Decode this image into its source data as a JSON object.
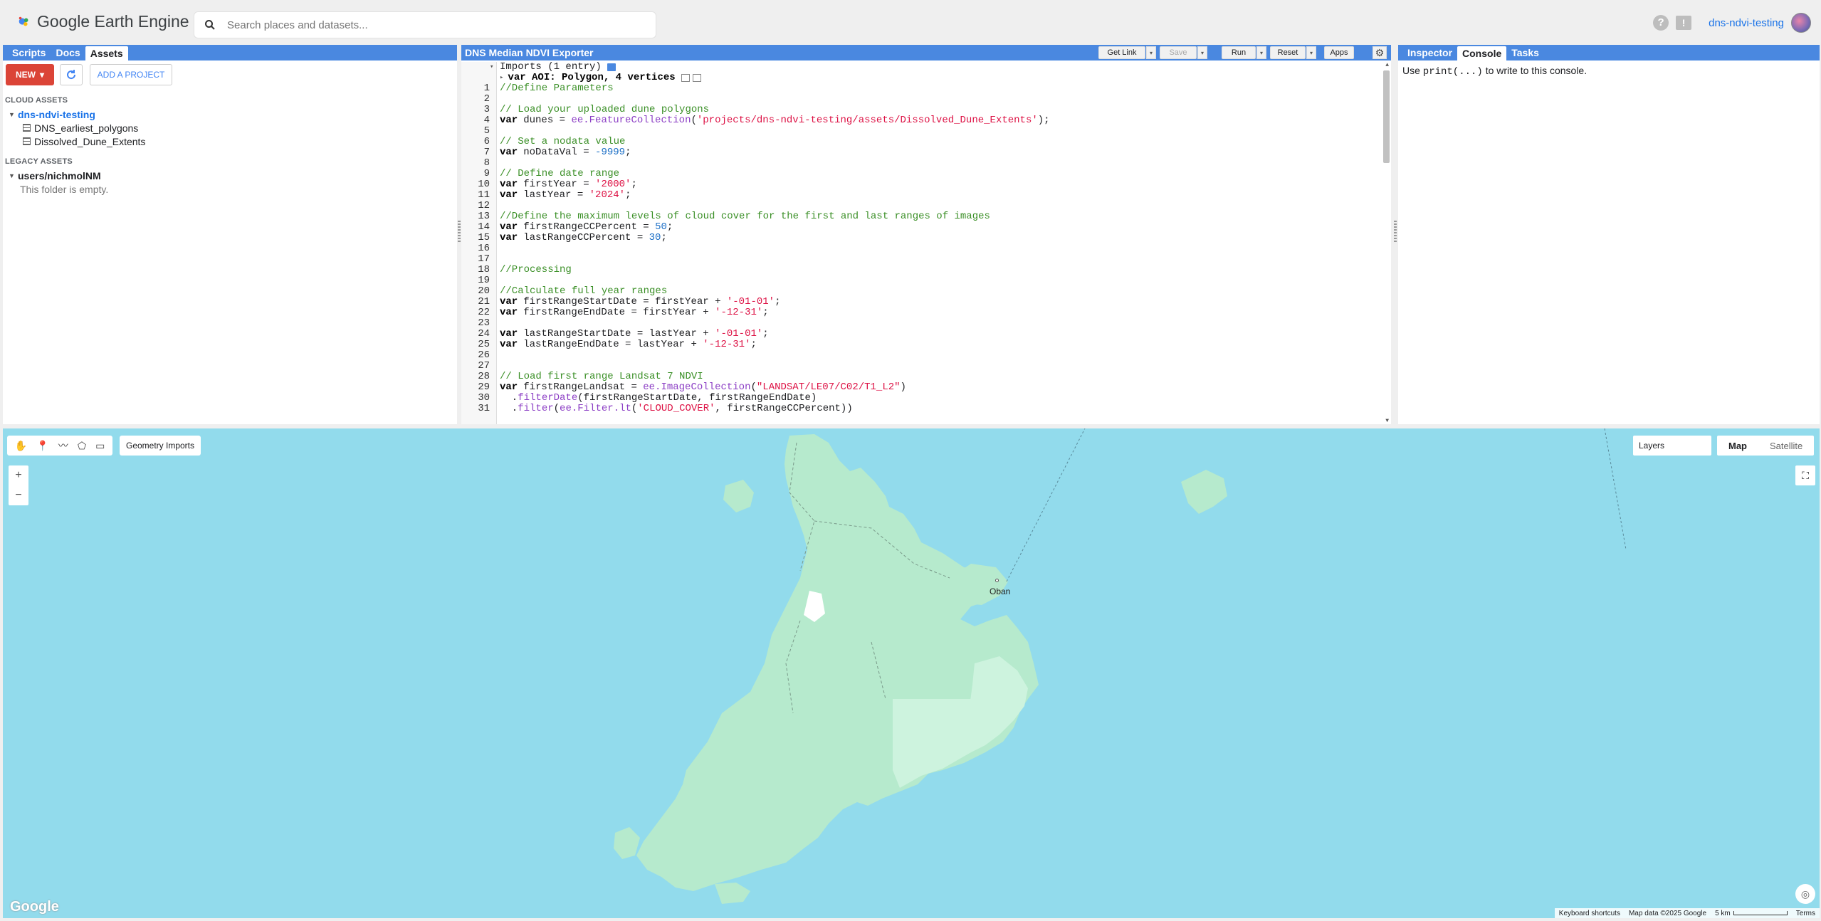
{
  "app": {
    "title": "Google Earth Engine"
  },
  "search": {
    "placeholder": "Search places and datasets..."
  },
  "topbar": {
    "project": "dns-ndvi-testing",
    "help": "?",
    "feedback": "!"
  },
  "left_panel": {
    "tabs": [
      "Scripts",
      "Docs",
      "Assets"
    ],
    "active_tab": "Assets",
    "new_label": "NEW",
    "add_project_label": "ADD A PROJECT",
    "cloud_assets_label": "CLOUD ASSETS",
    "cloud_project": "dns-ndvi-testing",
    "cloud_items": [
      "DNS_earliest_polygons",
      "Dissolved_Dune_Extents"
    ],
    "legacy_assets_label": "LEGACY ASSETS",
    "legacy_user": "users/nichmolNM",
    "empty_msg": "This folder is empty."
  },
  "editor": {
    "title": "DNS Median NDVI Exporter",
    "get_link": "Get Link",
    "save": "Save",
    "run": "Run",
    "reset": "Reset",
    "apps": "Apps",
    "imports_line": "Imports (1 entry)",
    "import_var": "var AOI: Polygon, 4 vertices",
    "code_lines": [
      [
        [
          "cm",
          "//Define Parameters"
        ]
      ],
      [],
      [
        [
          "cm",
          "// Load your uploaded dune polygons"
        ]
      ],
      [
        [
          "kw",
          "var"
        ],
        [
          "",
          "dunes = "
        ],
        [
          "fn",
          "ee.FeatureCollection"
        ],
        [
          "",
          "("
        ],
        [
          "st",
          "'projects/dns-ndvi-testing/assets/Dissolved_Dune_Extents'"
        ],
        [
          "",
          ");"
        ]
      ],
      [],
      [
        [
          "cm",
          "// Set a nodata value"
        ]
      ],
      [
        [
          "kw",
          "var"
        ],
        [
          "",
          "noDataVal = "
        ],
        [
          "nm",
          "-9999"
        ],
        [
          "",
          ";"
        ]
      ],
      [],
      [
        [
          "cm",
          "// Define date range"
        ]
      ],
      [
        [
          "kw",
          "var"
        ],
        [
          "",
          "firstYear = "
        ],
        [
          "st",
          "'2000'"
        ],
        [
          "",
          ";"
        ]
      ],
      [
        [
          "kw",
          "var"
        ],
        [
          "",
          "lastYear = "
        ],
        [
          "st",
          "'2024'"
        ],
        [
          "",
          ";"
        ]
      ],
      [],
      [
        [
          "cm",
          "//Define the maximum levels of cloud cover for the first and last ranges of images"
        ]
      ],
      [
        [
          "kw",
          "var"
        ],
        [
          "",
          "firstRangeCCPercent = "
        ],
        [
          "nm",
          "50"
        ],
        [
          "",
          ";"
        ]
      ],
      [
        [
          "kw",
          "var"
        ],
        [
          "",
          "lastRangeCCPercent = "
        ],
        [
          "nm",
          "30"
        ],
        [
          "",
          ";"
        ]
      ],
      [],
      [],
      [
        [
          "cm",
          "//Processing"
        ]
      ],
      [],
      [
        [
          "cm",
          "//Calculate full year ranges"
        ]
      ],
      [
        [
          "kw",
          "var"
        ],
        [
          "",
          "firstRangeStartDate = firstYear + "
        ],
        [
          "st",
          "'-01-01'"
        ],
        [
          "",
          ";"
        ]
      ],
      [
        [
          "kw",
          "var"
        ],
        [
          "",
          "firstRangeEndDate = firstYear + "
        ],
        [
          "st",
          "'-12-31'"
        ],
        [
          "",
          ";"
        ]
      ],
      [],
      [
        [
          "kw",
          "var"
        ],
        [
          "",
          "lastRangeStartDate = lastYear + "
        ],
        [
          "st",
          "'-01-01'"
        ],
        [
          "",
          ";"
        ]
      ],
      [
        [
          "kw",
          "var"
        ],
        [
          "",
          "lastRangeEndDate = lastYear + "
        ],
        [
          "st",
          "'-12-31'"
        ],
        [
          "",
          ";"
        ]
      ],
      [],
      [],
      [
        [
          "cm",
          "// Load first range Landsat 7 NDVI"
        ]
      ],
      [
        [
          "kw",
          "var"
        ],
        [
          "",
          "firstRangeLandsat = "
        ],
        [
          "fn",
          "ee.ImageCollection"
        ],
        [
          "",
          "("
        ],
        [
          "st",
          "\"LANDSAT/LE07/C02/T1_L2\""
        ],
        [
          "",
          ")"
        ]
      ],
      [
        [
          "",
          "  ."
        ],
        [
          "fn",
          "filterDate"
        ],
        [
          "",
          "(firstRangeStartDate, firstRangeEndDate)"
        ]
      ],
      [
        [
          "",
          "  ."
        ],
        [
          "fn",
          "filter"
        ],
        [
          "",
          "("
        ],
        [
          "fn",
          "ee.Filter.lt"
        ],
        [
          "",
          "("
        ],
        [
          "st",
          "'CLOUD_COVER'"
        ],
        [
          "",
          ", firstRangeCCPercent))"
        ]
      ]
    ]
  },
  "right_panel": {
    "tabs": [
      "Inspector",
      "Console",
      "Tasks"
    ],
    "active_tab": "Console",
    "console_pre": "Use ",
    "console_code": "print(...)",
    "console_post": " to write to this console."
  },
  "map": {
    "geometry_imports": "Geometry Imports",
    "layers": "Layers",
    "map_type": "Map",
    "satellite_type": "Satellite",
    "place_label": "Oban",
    "google": "Google",
    "shortcuts": "Keyboard shortcuts",
    "map_data": "Map data ©2025 Google",
    "scale": "5 km",
    "terms": "Terms",
    "colors": {
      "water": "#92dbec",
      "land": "#b6eacd",
      "land_light": "#cdf3de"
    }
  }
}
